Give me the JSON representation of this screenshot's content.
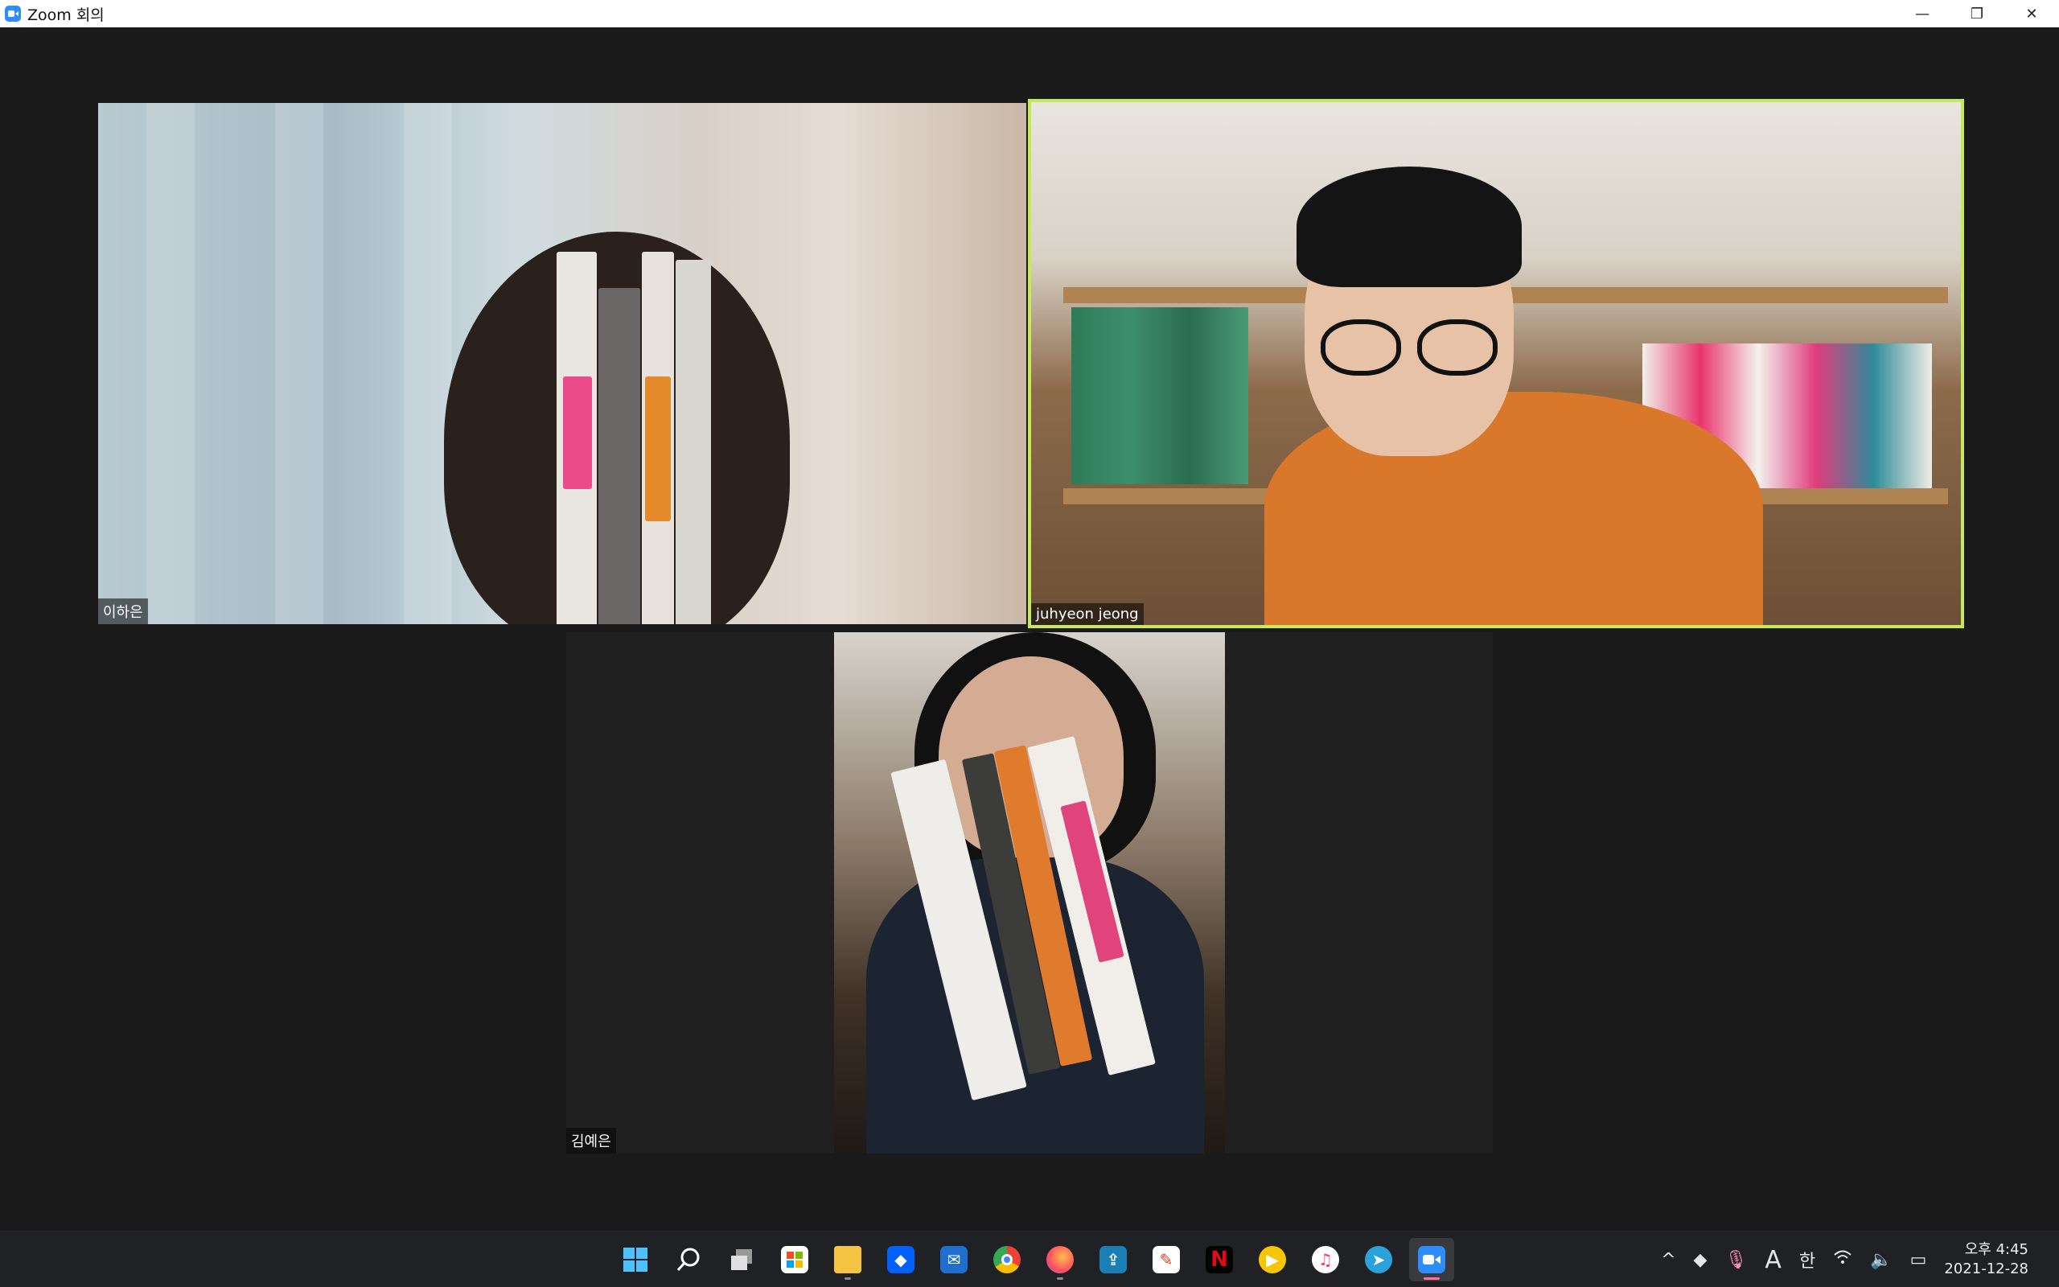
{
  "window": {
    "title": "Zoom 회의",
    "minimize": "—",
    "restore": "❐",
    "close": "✕"
  },
  "participants": [
    {
      "name": "이하은"
    },
    {
      "name": "juhyeon jeong",
      "active_speaker": true,
      "highlight_color": "#c6e95a"
    },
    {
      "name": "김예은"
    }
  ],
  "taskbar": {
    "apps": [
      {
        "name": "start-icon"
      },
      {
        "name": "search-icon"
      },
      {
        "name": "task-view-icon"
      },
      {
        "name": "store-icon"
      },
      {
        "name": "file-explorer-icon"
      },
      {
        "name": "dropbox-icon"
      },
      {
        "name": "mail-icon"
      },
      {
        "name": "chrome-icon"
      },
      {
        "name": "firefox-icon"
      },
      {
        "name": "app-icon"
      },
      {
        "name": "pen-icon"
      },
      {
        "name": "netflix-icon",
        "label": "N"
      },
      {
        "name": "media-player-icon"
      },
      {
        "name": "itunes-icon"
      },
      {
        "name": "telegram-icon"
      },
      {
        "name": "zoom-icon"
      }
    ],
    "tray": {
      "chevron": "^",
      "ime_label": "A",
      "lang_label": "한",
      "clock_time": "오후 4:45",
      "clock_date": "2021-12-28"
    }
  }
}
